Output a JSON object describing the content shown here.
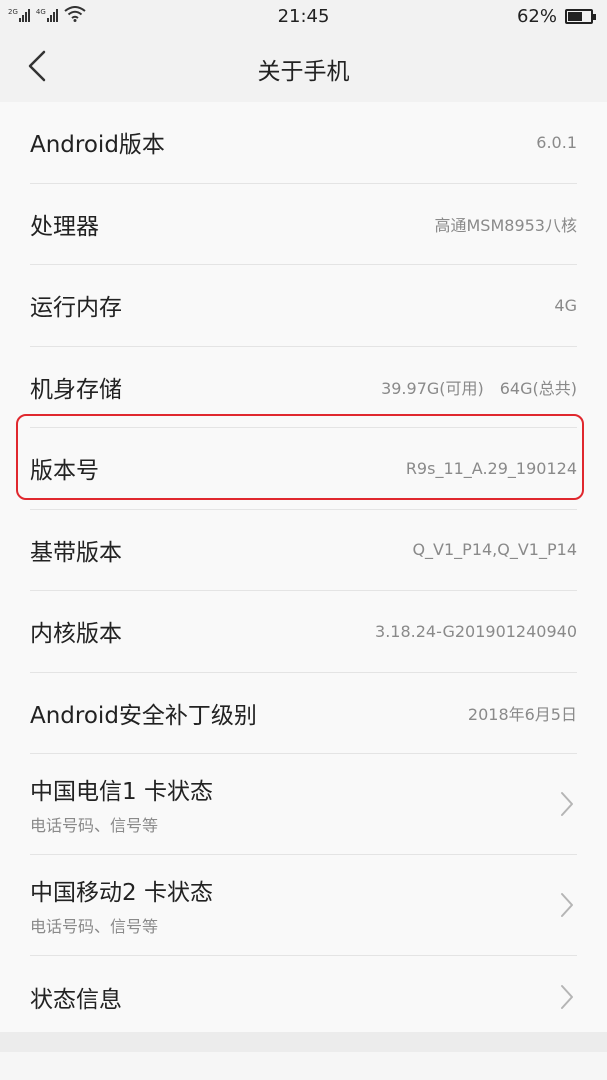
{
  "status_bar": {
    "sim1_label": "2G",
    "sim2_label": "4G",
    "time": "21:45",
    "battery_percent": "62%",
    "battery_level": 0.62
  },
  "header": {
    "title": "关于手机"
  },
  "items": [
    {
      "label": "Android版本",
      "value": "6.0.1"
    },
    {
      "label": "处理器",
      "value": "高通MSM8953八核"
    },
    {
      "label": "运行内存",
      "value": "4G"
    },
    {
      "label": "机身存储",
      "value": "39.97G(可用)　64G(总共)"
    },
    {
      "label": "版本号",
      "value": "R9s_11_A.29_190124"
    },
    {
      "label": "基带版本",
      "value": "Q_V1_P14,Q_V1_P14"
    },
    {
      "label": "内核版本",
      "value": "3.18.24-G201901240940"
    },
    {
      "label": "Android安全补丁级别",
      "value": "2018年6月5日"
    }
  ],
  "nav_items": [
    {
      "label": "中国电信1 卡状态",
      "sub": "电话号码、信号等"
    },
    {
      "label": "中国移动2 卡状态",
      "sub": "电话号码、信号等"
    },
    {
      "label": "状态信息"
    }
  ],
  "colors": {
    "highlight": "#e0282e"
  }
}
